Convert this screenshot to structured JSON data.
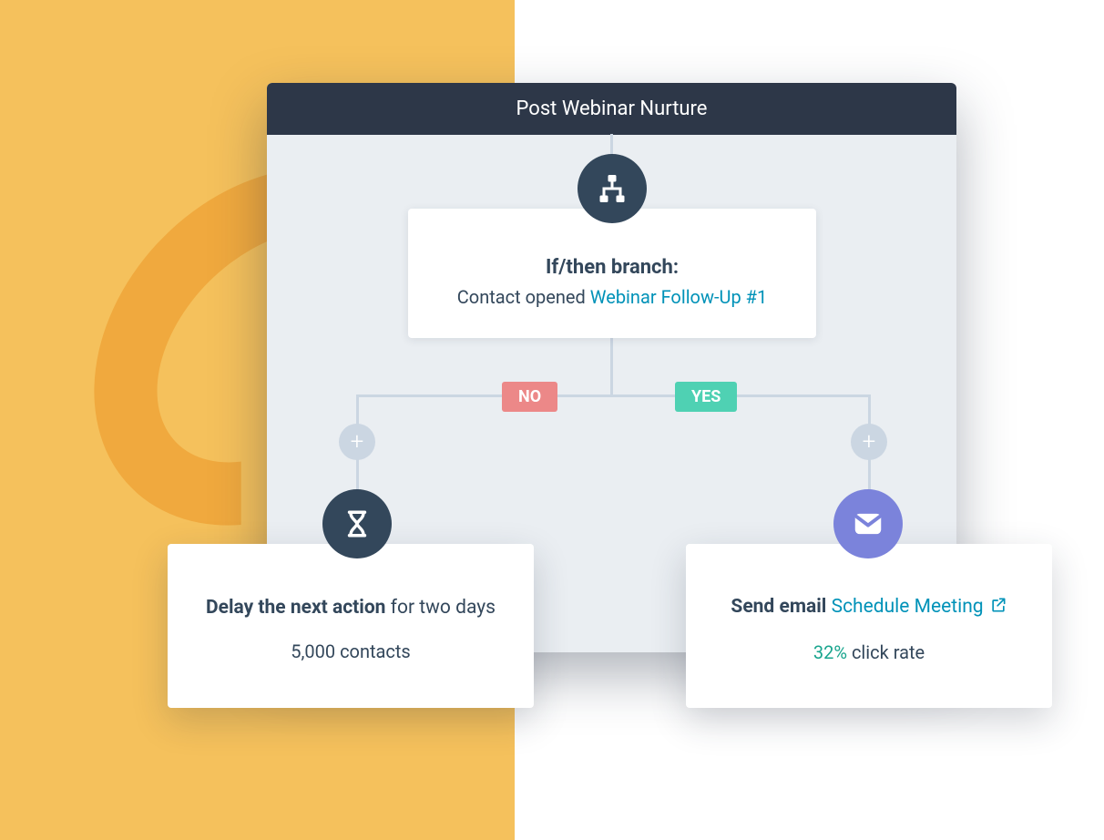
{
  "panel": {
    "title": "Post Webinar Nurture"
  },
  "branch": {
    "title": "If/then branch:",
    "desc_prefix": "Contact opened ",
    "link_text": "Webinar Follow-Up #1"
  },
  "badges": {
    "no": "NO",
    "yes": "YES"
  },
  "plus": {
    "left": "+",
    "right": "+"
  },
  "left_action": {
    "bold": "Delay the next action",
    "rest": " for two days",
    "stat": "5,000 contacts"
  },
  "right_action": {
    "bold": "Send email ",
    "link": "Schedule Meeting",
    "stat_value": "32%",
    "stat_rest": " click rate"
  }
}
